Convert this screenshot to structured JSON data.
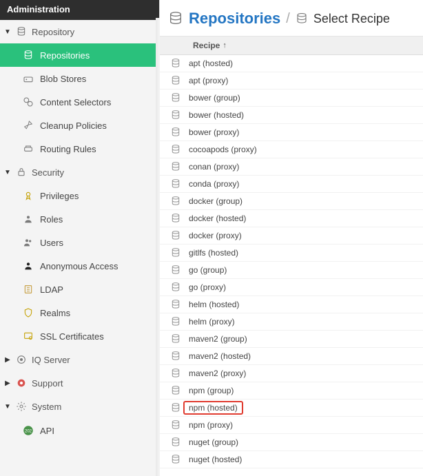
{
  "header": {
    "title": "Administration"
  },
  "sidebar": {
    "groups": [
      {
        "label": "Repository",
        "items": [
          {
            "label": "Repositories",
            "icon": "db",
            "active": true
          },
          {
            "label": "Blob Stores",
            "icon": "blob"
          },
          {
            "label": "Content Selectors",
            "icon": "content"
          },
          {
            "label": "Cleanup Policies",
            "icon": "broom"
          },
          {
            "label": "Routing Rules",
            "icon": "routing"
          }
        ]
      },
      {
        "label": "Security",
        "items": [
          {
            "label": "Privileges",
            "icon": "ribbon"
          },
          {
            "label": "Roles",
            "icon": "roles"
          },
          {
            "label": "Users",
            "icon": "users"
          },
          {
            "label": "Anonymous Access",
            "icon": "person"
          },
          {
            "label": "LDAP",
            "icon": "ldap"
          },
          {
            "label": "Realms",
            "icon": "shield"
          },
          {
            "label": "SSL Certificates",
            "icon": "cert"
          }
        ]
      },
      {
        "label": "IQ Server",
        "items": [],
        "icon": "iq"
      },
      {
        "label": "Support",
        "items": [],
        "icon": "support"
      },
      {
        "label": "System",
        "items": [
          {
            "label": "API",
            "icon": "api"
          }
        ]
      }
    ]
  },
  "main": {
    "title": "Repositories",
    "subtitle": "Select Recipe",
    "column": "Recipe",
    "recipes": [
      "apt (hosted)",
      "apt (proxy)",
      "bower (group)",
      "bower (hosted)",
      "bower (proxy)",
      "cocoapods (proxy)",
      "conan (proxy)",
      "conda (proxy)",
      "docker (group)",
      "docker (hosted)",
      "docker (proxy)",
      "gitlfs (hosted)",
      "go (group)",
      "go (proxy)",
      "helm (hosted)",
      "helm (proxy)",
      "maven2 (group)",
      "maven2 (hosted)",
      "maven2 (proxy)",
      "npm (group)",
      "npm (hosted)",
      "npm (proxy)",
      "nuget (group)",
      "nuget (hosted)"
    ],
    "highlight": "npm (hosted)"
  }
}
